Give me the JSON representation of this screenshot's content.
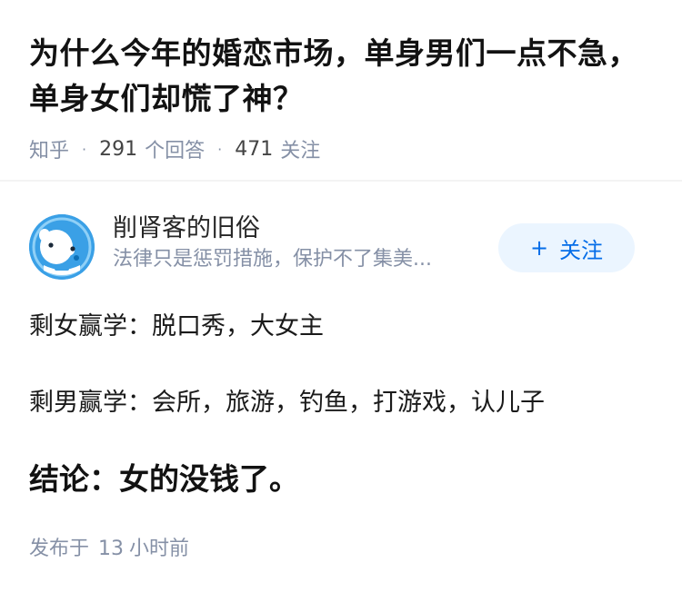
{
  "question": {
    "title": "为什么今年的婚恋市场，单身男们一点不急，单身女们却慌了神？",
    "source": "知乎",
    "answers_count": "291",
    "answers_label": "个回答",
    "followers_count": "471",
    "followers_label": "关注",
    "separator": "·"
  },
  "author": {
    "name": "削肾客的旧俗",
    "bio": "法律只是惩罚措施，保护不了集美...",
    "avatar_icon": "cartoon-bear-avatar"
  },
  "follow_button": {
    "plus": "+",
    "label": "关注",
    "accent": "#056de8",
    "background": "#ebf5ff"
  },
  "content": {
    "paragraphs": [
      "剩女赢学：脱口秀，大女主",
      "剩男赢学：会所，旅游，钓鱼，打游戏，认儿子"
    ],
    "conclusion": "结论：女的没钱了。"
  },
  "footer": {
    "published_prefix": "发布于",
    "published_value": "13",
    "published_suffix": "小时前"
  },
  "colors": {
    "meta_gray": "#8590a6",
    "avatar_blue": "#3aa0e6"
  }
}
